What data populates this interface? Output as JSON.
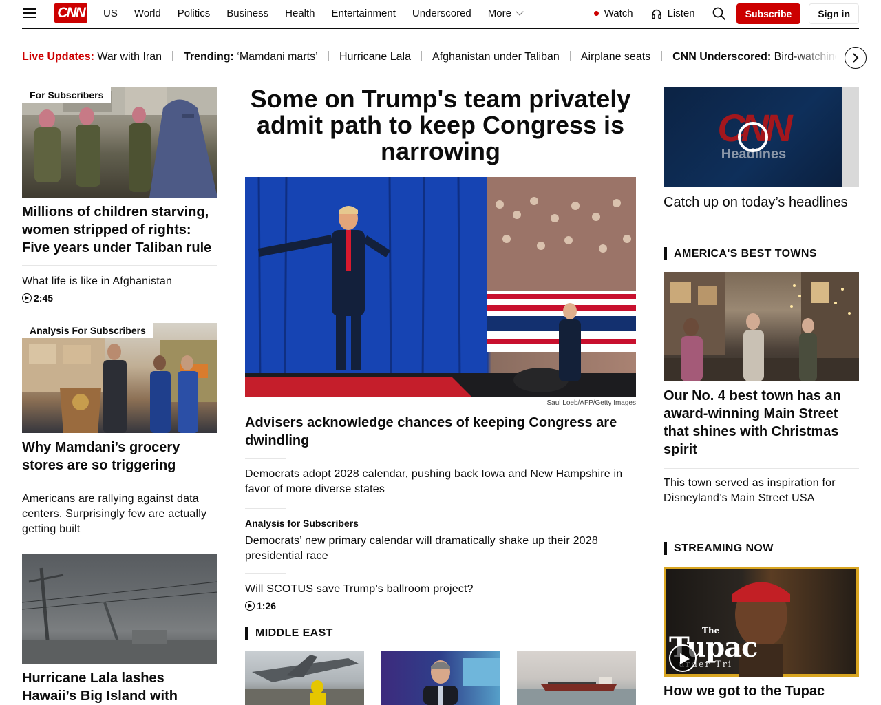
{
  "header": {
    "logo_text": "CNN",
    "nav": [
      "US",
      "World",
      "Politics",
      "Business",
      "Health",
      "Entertainment",
      "Underscored"
    ],
    "more_label": "More",
    "watch_label": "Watch",
    "listen_label": "Listen",
    "subscribe_label": "Subscribe",
    "signin_label": "Sign in"
  },
  "trending": {
    "live_label": "Live Updates:",
    "live_text": "War with Iran",
    "trending_label": "Trending:",
    "trending_text": "‘Mamdani marts’",
    "items": [
      "Hurricane Lala",
      "Afghanistan under Taliban",
      "Airplane seats"
    ],
    "underscored_label": "CNN Underscored:",
    "underscored_text": "Bird-watching"
  },
  "left": {
    "story1": {
      "badge": "For Subscribers",
      "headline": "Millions of children starving, women stripped of rights: Five years under Taliban rule",
      "sub": "What life is like in Afghanistan",
      "duration": "2:45"
    },
    "story2": {
      "badge": "Analysis For Subscribers",
      "headline": "Why Mamdani’s grocery stores are so triggering",
      "sub": "Americans are rallying against data centers. Surprisingly few are actually getting built"
    },
    "story3": {
      "headline": "Hurricane Lala lashes Hawaii’s Big Island with"
    }
  },
  "center": {
    "main_headline": "Some on Trump's team privately admit path to keep Congress is narrowing",
    "photo_credit": "Saul Loeb/AFP/Getty Images",
    "lead_link": "Advisers acknowledge chances of keeping Congress are dwindling",
    "link2": "Democrats adopt 2028 calendar, pushing back Iowa and New Hampshire in favor of more diverse states",
    "analysis_label": "Analysis for Subscribers",
    "link3": "Democrats’ new primary calendar will dramatically shake up their 2028 presidential race",
    "link4": "Will SCOTUS save Trump’s ballroom project?",
    "link4_duration": "1:26",
    "section_title": "MIDDLE EAST"
  },
  "right": {
    "video_title": "Catch up on today’s headlines",
    "cnn_headlines_logo": "CNN",
    "cnn_headlines_word": "Headlines",
    "section1_title": "AMERICA'S BEST TOWNS",
    "town_headline": "Our No. 4 best town has an award-winning Main Street that shines with Christmas spirit",
    "town_sub": "This town served as inspiration for Disneyland’s Main Street USA",
    "section2_title": "STREAMING NOW",
    "tupac_overlay_the": "The",
    "tupac_overlay_name": "Tupac",
    "tupac_overlay_tail": "urder Tri",
    "tupac_headline": "How we got to the Tupac"
  }
}
